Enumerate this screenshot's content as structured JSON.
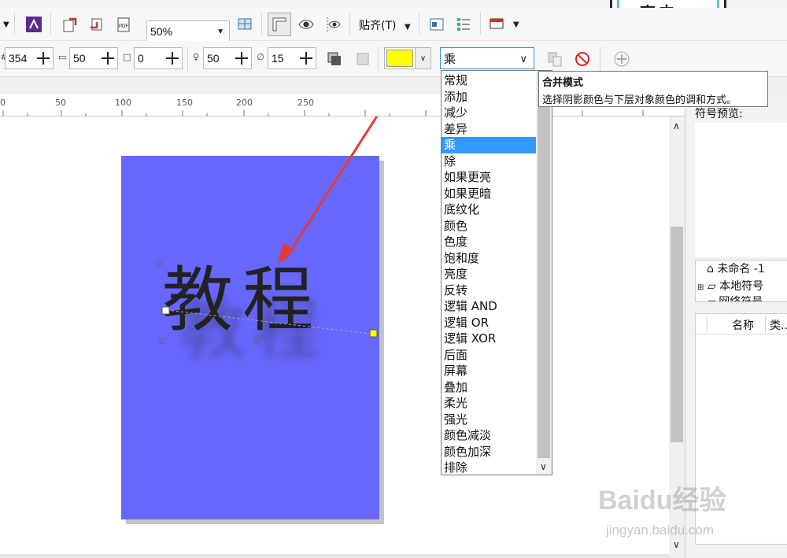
{
  "banner": {
    "text": "高中。"
  },
  "toolbar": {
    "zoom": "50%",
    "snap_label": "贴齐(T)"
  },
  "property_bar": {
    "x_value": "354",
    "y_value": "50",
    "offset_value": "0",
    "opacity_value": "50",
    "feather_value": "15",
    "shadow_color": "#ffff00",
    "blend_mode": "乘"
  },
  "ruler": {
    "ticks": [
      "0",
      "50",
      "100",
      "150",
      "200",
      "250"
    ]
  },
  "canvas": {
    "text": "教程",
    "page_color": "#6767ff"
  },
  "blend_dropdown": {
    "selected": "乘",
    "options": [
      "常规",
      "添加",
      "减少",
      "差异",
      "乘",
      "除",
      "如果更亮",
      "如果更暗",
      "底纹化",
      "颜色",
      "色度",
      "饱和度",
      "亮度",
      "反转",
      "逻辑 AND",
      "逻辑 OR",
      "逻辑 XOR",
      "后面",
      "屏幕",
      "叠加",
      "柔光",
      "强光",
      "颜色减淡",
      "颜色加深",
      "排除"
    ]
  },
  "tooltip": {
    "title": "合并模式",
    "body": "选择阴影颜色与下层对象颜色的调和方式。"
  },
  "right_panel": {
    "preview_title": "符号预览:",
    "tree_item_1": "未命名 -1",
    "tree_item_2": "本地符号",
    "tree_item_3": "网络符号",
    "col_name": "名称",
    "col_type": "类..."
  },
  "watermark": {
    "logo": "Baidu经验",
    "url": "jingyan.baidu.com"
  }
}
